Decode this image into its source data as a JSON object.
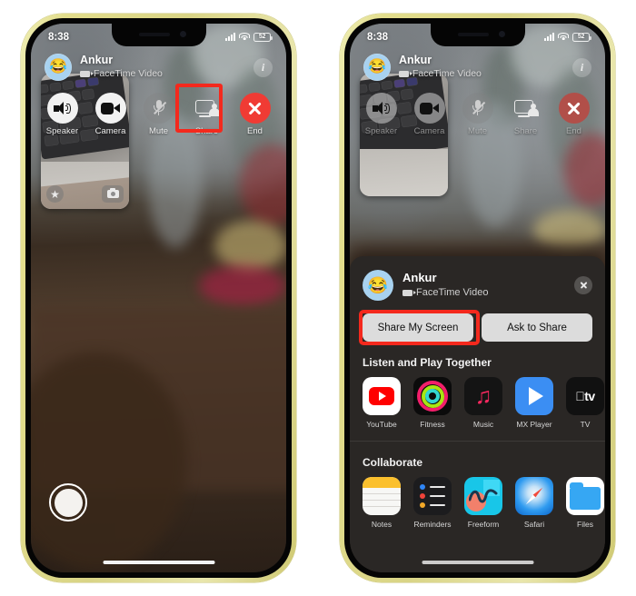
{
  "page": {
    "background_color": "#ffffff",
    "device_frame_color": "#e2dd8c"
  },
  "phones": [
    {
      "id": "left",
      "status_bar": {
        "time": "8:38",
        "battery_level": "52",
        "cellular": "4 bars",
        "wifi": "connected"
      },
      "call_header": {
        "name": "Ankur",
        "subtitle": "FaceTime Video",
        "info_label": "i",
        "avatar_emoji": "😂"
      },
      "controls": [
        {
          "label": "Speaker",
          "icon": "speaker-icon",
          "style": "light",
          "highlighted": false
        },
        {
          "label": "Camera",
          "icon": "camera-icon",
          "style": "light",
          "highlighted": false
        },
        {
          "label": "Mute",
          "icon": "mic-off-icon",
          "style": "ghost",
          "highlighted": false
        },
        {
          "label": "Share",
          "icon": "screen-share-icon",
          "style": "none",
          "highlighted": true
        },
        {
          "label": "End",
          "icon": "end-call-icon",
          "style": "red",
          "highlighted": false
        }
      ],
      "highlight_color": "#f4291d",
      "pip": {
        "star_icon": "star-icon",
        "flip_camera_icon": "flip-camera-icon"
      },
      "shutter_button": "shutter-button",
      "sheet_open": false
    },
    {
      "id": "right",
      "status_bar": {
        "time": "8:38",
        "battery_level": "52",
        "cellular": "4 bars",
        "wifi": "connected"
      },
      "call_header": {
        "name": "Ankur",
        "subtitle": "FaceTime Video",
        "info_label": "i",
        "avatar_emoji": "😂"
      },
      "controls": [
        {
          "label": "Speaker",
          "icon": "speaker-icon",
          "style": "light",
          "highlighted": false
        },
        {
          "label": "Camera",
          "icon": "camera-icon",
          "style": "light",
          "highlighted": false
        },
        {
          "label": "Mute",
          "icon": "mic-off-icon",
          "style": "ghost",
          "highlighted": false
        },
        {
          "label": "Share",
          "icon": "screen-share-icon",
          "style": "none",
          "highlighted": false
        },
        {
          "label": "End",
          "icon": "end-call-icon",
          "style": "red",
          "highlighted": false
        }
      ],
      "highlight_color": "#f4291d",
      "sheet_open": true
    }
  ],
  "share_sheet": {
    "header": {
      "name": "Ankur",
      "subtitle": "FaceTime Video",
      "avatar_emoji": "😂",
      "close_icon": "close-icon"
    },
    "primary_buttons": [
      {
        "label": "Share My Screen",
        "highlighted": true
      },
      {
        "label": "Ask to Share",
        "highlighted": false
      }
    ],
    "sections": [
      {
        "title": "Listen and Play Together",
        "apps": [
          {
            "label": "YouTube",
            "icon": "youtube-icon"
          },
          {
            "label": "Fitness",
            "icon": "fitness-icon"
          },
          {
            "label": "Music",
            "icon": "music-icon"
          },
          {
            "label": "MX Player",
            "icon": "mx-player-icon"
          },
          {
            "label": "TV",
            "icon": "apple-tv-icon"
          }
        ]
      },
      {
        "title": "Collaborate",
        "apps": [
          {
            "label": "Notes",
            "icon": "notes-icon"
          },
          {
            "label": "Reminders",
            "icon": "reminders-icon"
          },
          {
            "label": "Freeform",
            "icon": "freeform-icon"
          },
          {
            "label": "Safari",
            "icon": "safari-icon"
          },
          {
            "label": "Files",
            "icon": "files-icon"
          }
        ]
      }
    ]
  }
}
